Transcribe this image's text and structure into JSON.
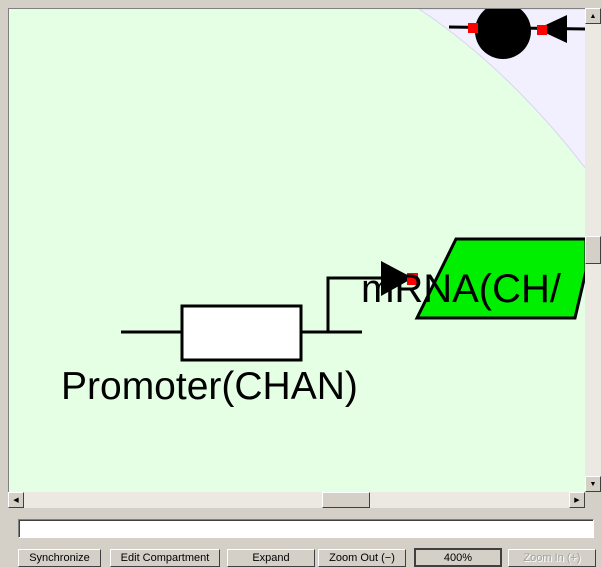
{
  "canvas": {
    "background": "#e5ffe5",
    "compartment_color": "#f2f0ff",
    "promoter_label": "Promoter(CHAN)",
    "mrna_label": "mRNA(CH/",
    "mrna_color": "#00ee00",
    "port_color": "#ff0000"
  },
  "status": {
    "text": ""
  },
  "toolbar": {
    "synchronize": "Synchronize",
    "edit_compartment": "Edit Compartment",
    "expand": "Expand",
    "zoom_out": "Zoom Out (−)",
    "zoom_level": "400%",
    "zoom_in": "Zoom In (+)"
  },
  "icons": {
    "arrow_up": "▲",
    "arrow_down": "▼",
    "arrow_left": "◀",
    "arrow_right": "▶"
  }
}
